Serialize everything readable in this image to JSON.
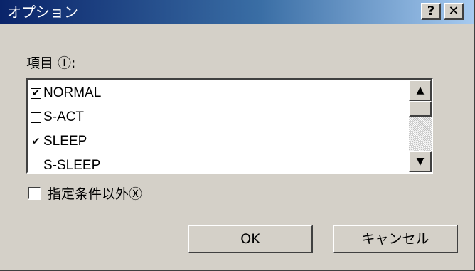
{
  "window": {
    "title": "オプション",
    "help_button": "?",
    "close_button": "✕"
  },
  "items_label": "項目 Ⓘ:",
  "list": {
    "items": [
      {
        "label": "NORMAL",
        "checked": true,
        "mark": "✔"
      },
      {
        "label": "S-ACT",
        "checked": false,
        "mark": ""
      },
      {
        "label": "SLEEP",
        "checked": true,
        "mark": "✔"
      },
      {
        "label": "S-SLEEP",
        "checked": false,
        "mark": ""
      }
    ],
    "scroll_up": "▲",
    "scroll_down": "▼"
  },
  "except_option": {
    "label": "指定条件以外Ⓧ",
    "checked": false
  },
  "buttons": {
    "ok": "OK",
    "cancel": "キャンセル"
  }
}
